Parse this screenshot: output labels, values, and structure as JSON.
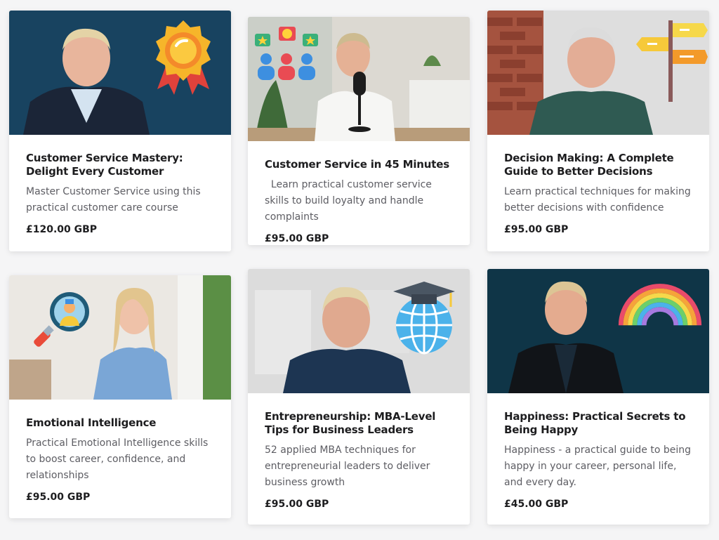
{
  "courses": [
    {
      "title": "Customer Service Mastery: Delight Every Customer",
      "description": "Master Customer Service using this practical customer care course",
      "price": "£120.00 GBP",
      "icon": "award-badge-icon"
    },
    {
      "title": "Customer Service in 45 Minutes",
      "description": "  Learn practical customer service skills to build loyalty and handle complaints",
      "price": "£95.00 GBP",
      "icon": "customer-reviews-icon"
    },
    {
      "title": "Decision Making: A Complete Guide to Better Decisions",
      "description": "Learn practical techniques for making better decisions with confidence",
      "price": "£95.00 GBP",
      "icon": "signpost-icon"
    },
    {
      "title": "Emotional Intelligence",
      "description": "Practical Emotional Intelligence skills to boost career, confidence, and relationships",
      "price": "£95.00 GBP",
      "icon": "magnifier-person-icon"
    },
    {
      "title": "Entrepreneurship: MBA-Level Tips for Business Leaders",
      "description": "52 applied MBA techniques for entrepreneurial leaders to deliver business growth",
      "price": "£95.00 GBP",
      "icon": "graduation-globe-icon"
    },
    {
      "title": "Happiness: Practical Secrets to Being Happy",
      "description": "Happiness - a practical guide to being happy in your career, personal life, and every day.",
      "price": "£45.00 GBP",
      "icon": "rainbow-icon"
    }
  ],
  "colors": {
    "page_bg": "#f5f5f6",
    "card_bg": "#ffffff",
    "title": "#1d1d1f",
    "text": "#5d5d63",
    "navy_bg": "#173a55",
    "teal_bg": "#0f3547"
  }
}
